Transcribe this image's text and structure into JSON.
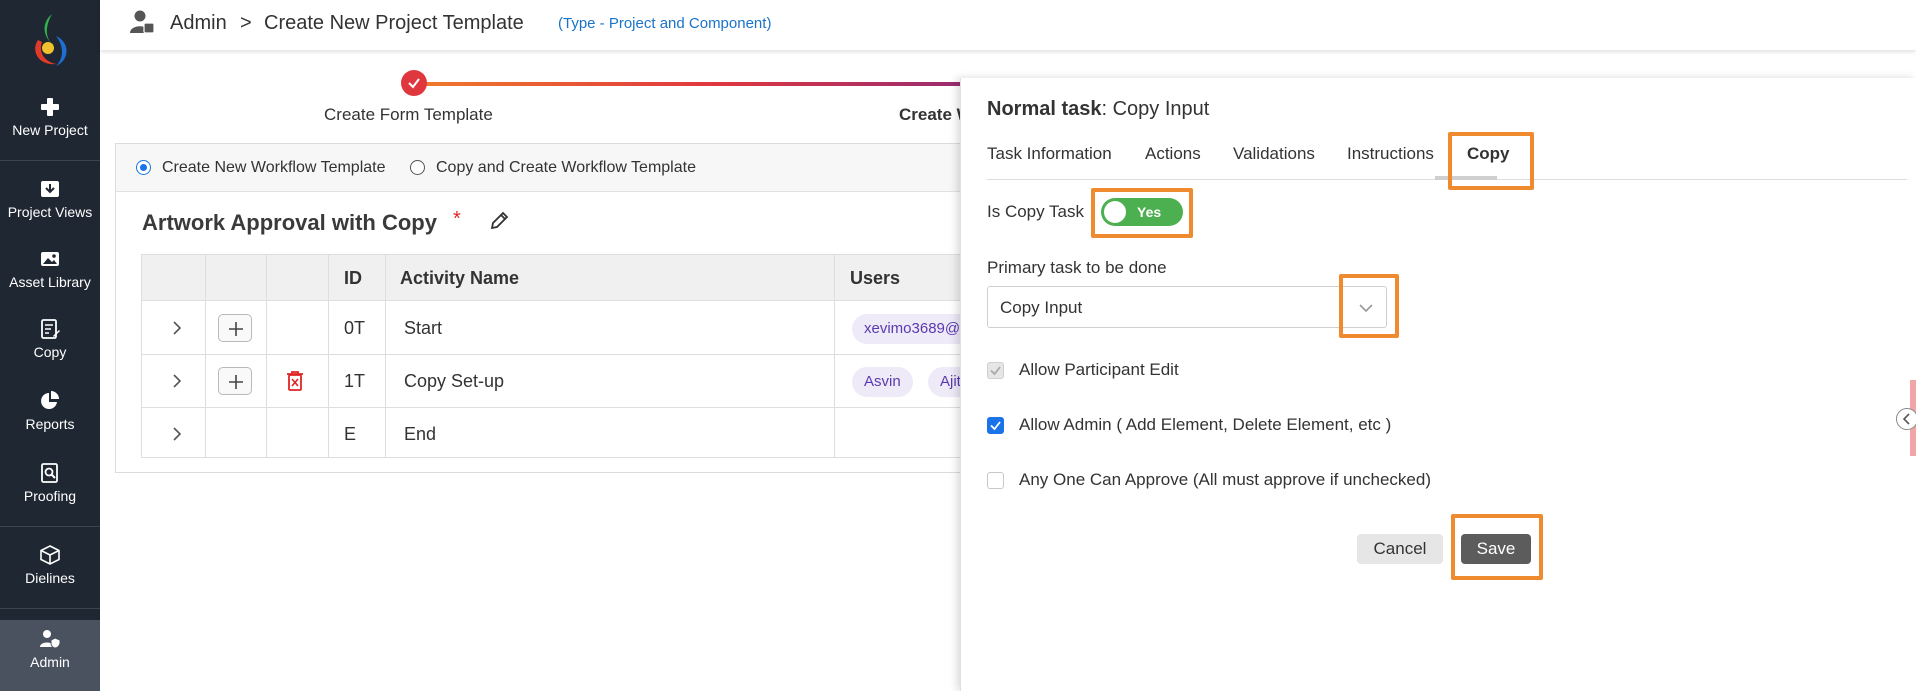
{
  "sidebar": {
    "items": [
      {
        "label": "New Project"
      },
      {
        "label": "Project Views"
      },
      {
        "label": "Asset Library"
      },
      {
        "label": "Copy"
      },
      {
        "label": "Reports"
      },
      {
        "label": "Proofing"
      },
      {
        "label": "Dielines"
      },
      {
        "label": "Admin"
      }
    ]
  },
  "header": {
    "admin": "Admin",
    "separator": ">",
    "title": "Create New Project Template",
    "type": "(Type - Project and Component)"
  },
  "stepper": {
    "step1": "Create Form Template",
    "step2": "Create W"
  },
  "workflow": {
    "radio_new": "Create New Workflow Template",
    "radio_copy": "Copy and Create Workflow Template",
    "title": "Artwork Approval with Copy",
    "required_mark": "*",
    "columns": [
      "ID",
      "Activity Name",
      "Users"
    ],
    "rows": [
      {
        "id": "0T",
        "name": "Start",
        "users": [
          "xevimo3689@"
        ]
      },
      {
        "id": "1T",
        "name": "Copy Set-up",
        "users": [
          "Asvin",
          "Ajit"
        ]
      },
      {
        "id": "E",
        "name": "End",
        "users": []
      }
    ]
  },
  "panel": {
    "title_prefix": "Normal task",
    "title_suffix": ": Copy Input",
    "tabs": [
      "Task Information",
      "Actions",
      "Validations",
      "Instructions",
      "Copy"
    ],
    "is_copy_task_label": "Is Copy Task",
    "toggle_value": "Yes",
    "primary_task_label": "Primary task to be done",
    "primary_task_value": "Copy Input",
    "checkboxes": [
      {
        "label": "Allow Participant Edit"
      },
      {
        "label": "Allow Admin ( Add Element, Delete Element, etc )"
      },
      {
        "label": "Any One Can Approve (All must approve if unchecked)"
      }
    ],
    "cancel_label": "Cancel",
    "save_label": "Save"
  },
  "colors": {
    "sidebar_bg": "#1f2733",
    "accent_blue": "#1a73e8",
    "highlight_orange": "#f08a2e",
    "toggle_green": "#4caf50",
    "danger_red": "#e02424"
  }
}
